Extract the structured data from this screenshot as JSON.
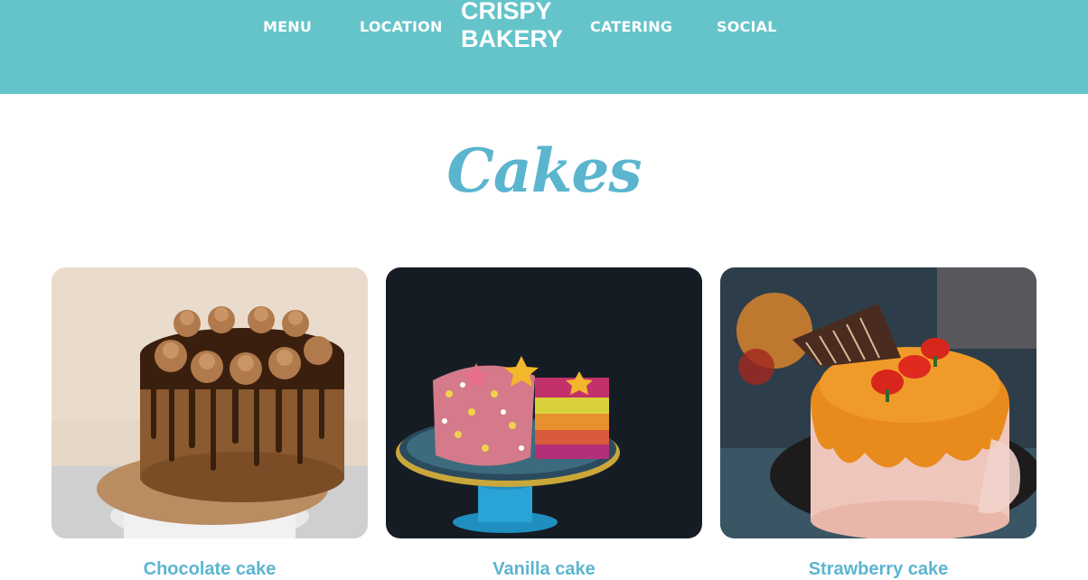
{
  "header": {
    "nav_left": [
      "MENU",
      "LOCATION"
    ],
    "brand_line1": "CRISPY",
    "brand_line2": "BAKERY",
    "nav_right": [
      "CATERING",
      "SOCIAL"
    ]
  },
  "section": {
    "title": "Cakes"
  },
  "cakes": [
    {
      "name": "Chocolate cake"
    },
    {
      "name": "Vanilla cake"
    },
    {
      "name": "Strawberry cake"
    }
  ],
  "colors": {
    "header_bg": "#64c4ca",
    "accent": "#5bb5cf"
  }
}
